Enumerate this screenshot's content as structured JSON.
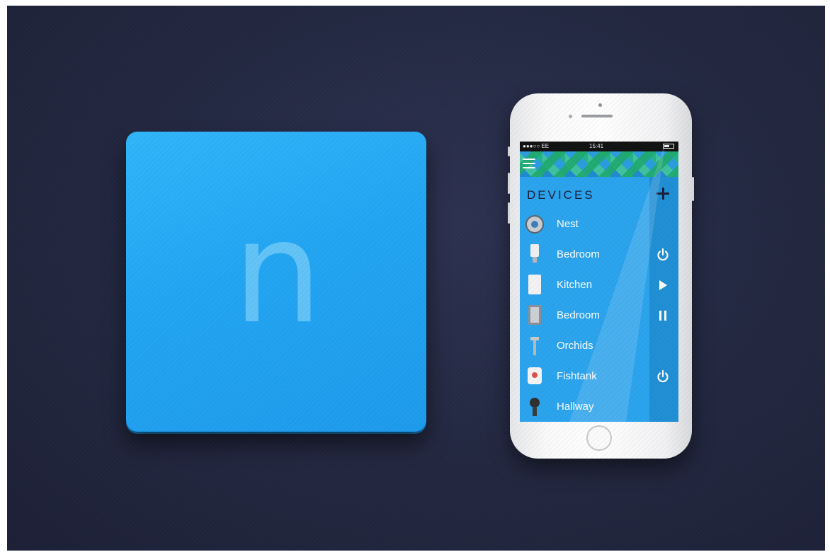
{
  "hub": {
    "glyph": "n",
    "color": "#22a6f3"
  },
  "phone": {
    "status_bar": {
      "carrier": "●●●○○ EE",
      "time": "15:41"
    },
    "menu_icon": "hamburger-menu-icon",
    "title": "DEVICES",
    "add_icon": "plus-icon",
    "devices": [
      {
        "label": "Nest",
        "icon": "thermostat-icon",
        "action": ""
      },
      {
        "label": "Bedroom",
        "icon": "light-bulb-icon",
        "action": "power-icon"
      },
      {
        "label": "Kitchen",
        "icon": "speaker-icon",
        "action": "play-icon"
      },
      {
        "label": "Bedroom",
        "icon": "speaker-icon",
        "action": "pause-icon"
      },
      {
        "label": "Orchids",
        "icon": "plant-sensor-icon",
        "action": ""
      },
      {
        "label": "Fishtank",
        "icon": "smart-plug-icon",
        "action": "power-icon"
      },
      {
        "label": "Hallway",
        "icon": "camera-icon",
        "action": ""
      }
    ],
    "accent": "#2aa4ee"
  }
}
